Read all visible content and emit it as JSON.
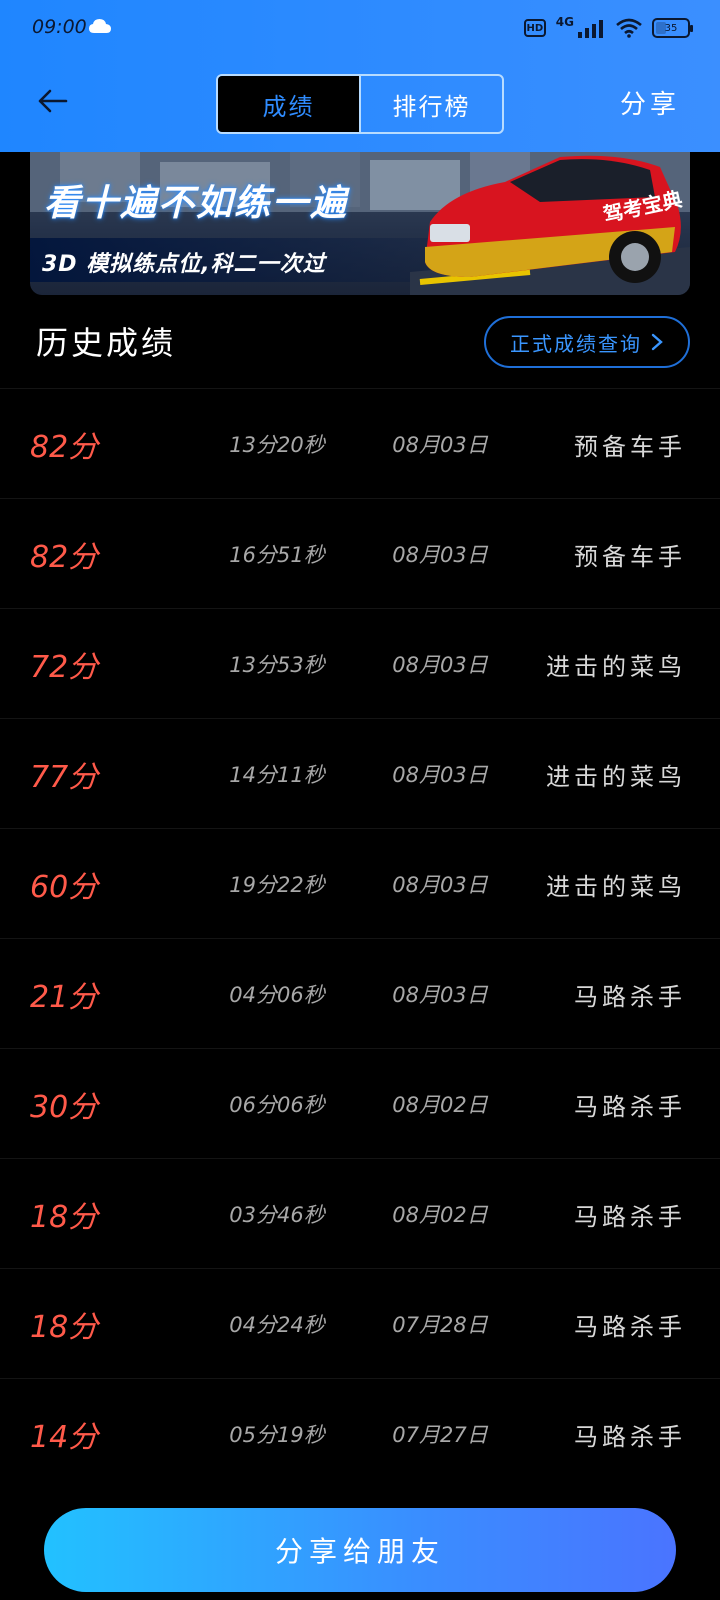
{
  "status_bar": {
    "time": "09:00",
    "hd": "HD",
    "network": "4G",
    "battery": "35"
  },
  "header": {
    "tabs": [
      {
        "label": "成绩",
        "active": true
      },
      {
        "label": "排行榜",
        "active": false
      }
    ],
    "share_label": "分享"
  },
  "banner": {
    "title": "看十遍不如练一遍",
    "subtitle": "3D 模拟练点位,科二一次过",
    "car_text": "驾考宝典"
  },
  "section": {
    "title": "历史成绩",
    "query_button": "正式成绩查询"
  },
  "records": [
    {
      "score": "82分",
      "duration": "13分20秒",
      "date": "08月03日",
      "rank": "预备车手"
    },
    {
      "score": "82分",
      "duration": "16分51秒",
      "date": "08月03日",
      "rank": "预备车手"
    },
    {
      "score": "72分",
      "duration": "13分53秒",
      "date": "08月03日",
      "rank": "进击的菜鸟"
    },
    {
      "score": "77分",
      "duration": "14分11秒",
      "date": "08月03日",
      "rank": "进击的菜鸟"
    },
    {
      "score": "60分",
      "duration": "19分22秒",
      "date": "08月03日",
      "rank": "进击的菜鸟"
    },
    {
      "score": "21分",
      "duration": "04分06秒",
      "date": "08月03日",
      "rank": "马路杀手"
    },
    {
      "score": "30分",
      "duration": "06分06秒",
      "date": "08月02日",
      "rank": "马路杀手"
    },
    {
      "score": "18分",
      "duration": "03分46秒",
      "date": "08月02日",
      "rank": "马路杀手"
    },
    {
      "score": "18分",
      "duration": "04分24秒",
      "date": "07月28日",
      "rank": "马路杀手"
    },
    {
      "score": "14分",
      "duration": "05分19秒",
      "date": "07月27日",
      "rank": "马路杀手"
    }
  ],
  "bottom": {
    "share_button": "分享给朋友"
  },
  "colors": {
    "header_blue": "#2e8bff",
    "score_red": "#ff5a4a",
    "link_blue": "#3a96ff"
  },
  "icons": [
    "cloud-icon",
    "signal-icon",
    "wifi-icon",
    "battery-icon",
    "back-arrow-icon",
    "chevron-right-icon"
  ]
}
